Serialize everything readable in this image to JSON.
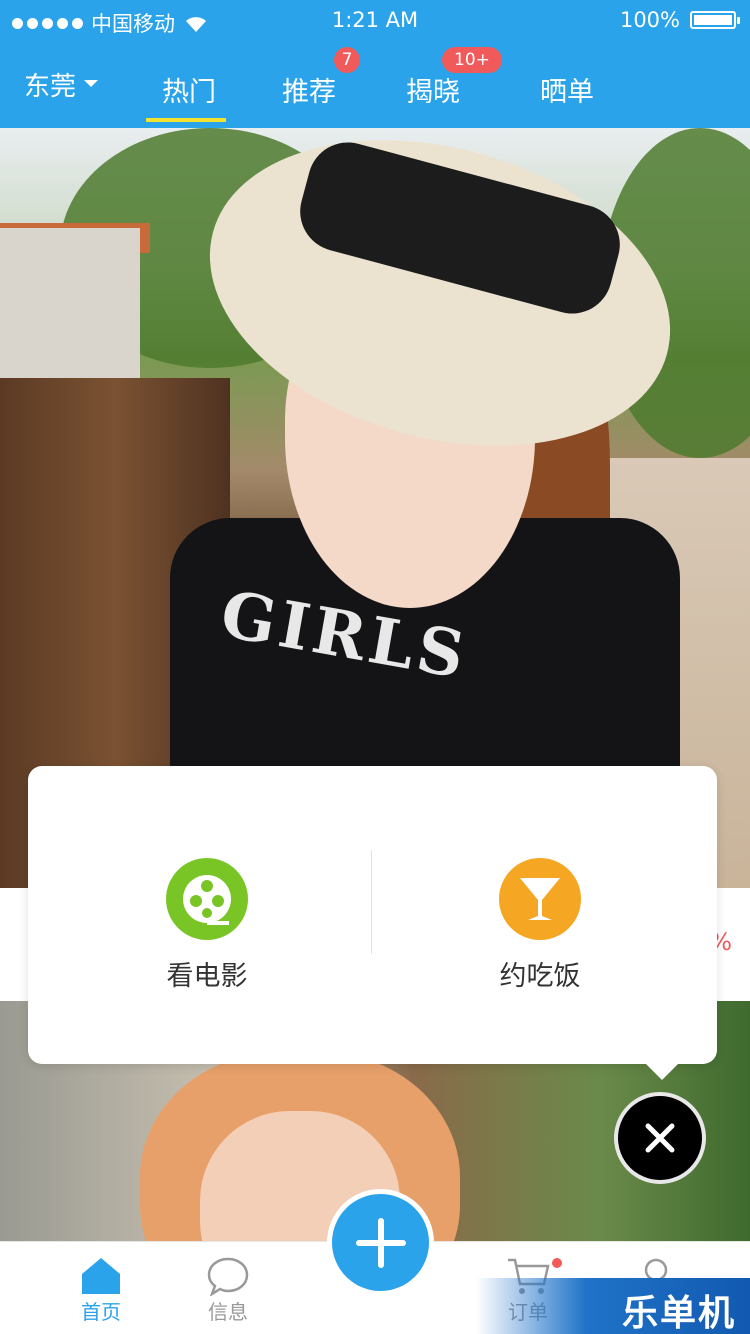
{
  "status_bar": {
    "carrier": "中国移动",
    "time": "1:21 AM",
    "battery": "100%"
  },
  "header": {
    "city": "东莞",
    "tabs": [
      {
        "label": "热门",
        "badge": ""
      },
      {
        "label": "推荐",
        "badge": "7"
      },
      {
        "label": "揭晓",
        "badge": "10+"
      },
      {
        "label": "晒单",
        "badge": ""
      }
    ]
  },
  "feed": {
    "shirt_text": "GIRLS",
    "partial_text": "%"
  },
  "popup": {
    "options": [
      {
        "label": "看电影",
        "icon": "film-reel-icon",
        "color": "#7ac526"
      },
      {
        "label": "约吃饭",
        "icon": "cocktail-glass-icon",
        "color": "#f5a623"
      }
    ]
  },
  "tabbar": {
    "items": [
      {
        "label": "首页",
        "icon": "home-icon"
      },
      {
        "label": "信息",
        "icon": "chat-bubble-icon"
      },
      {
        "label": "订单",
        "icon": "cart-icon"
      },
      {
        "label": "",
        "icon": "user-icon"
      }
    ]
  },
  "watermark": "乐单机",
  "colors": {
    "primary": "#2aa3ea",
    "accent_underline": "#f4e130",
    "badge": "#f05a5a"
  }
}
